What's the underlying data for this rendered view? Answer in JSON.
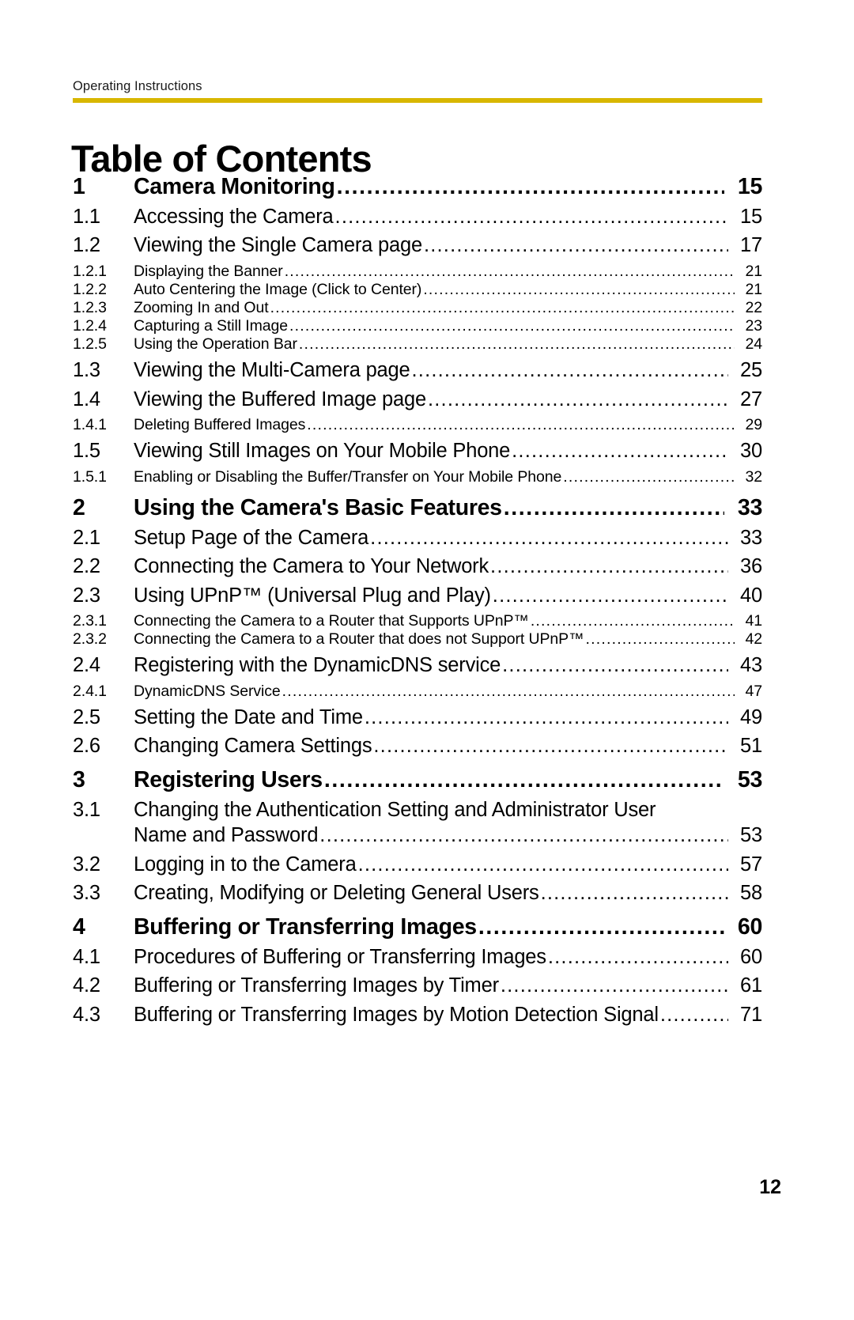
{
  "document": {
    "running_header": "Operating Instructions",
    "title": "Table of Contents",
    "footer_page_number": "12",
    "accent_rule_color": "#d8b700",
    "text_color": "#000000",
    "background_color": "#ffffff"
  },
  "toc": {
    "entries": [
      {
        "level": "chapter",
        "num": "1",
        "label": "Camera Monitoring",
        "page": "15"
      },
      {
        "level": "section",
        "num": "1.1",
        "label": "Accessing the Camera",
        "page": "15"
      },
      {
        "level": "section",
        "num": "1.2",
        "label": "Viewing the Single Camera page",
        "page": "17"
      },
      {
        "level": "sub",
        "num": "1.2.1",
        "label": "Displaying the Banner",
        "page": "21"
      },
      {
        "level": "sub",
        "num": "1.2.2",
        "label": "Auto Centering the Image (Click to Center)",
        "page": "21"
      },
      {
        "level": "sub",
        "num": "1.2.3",
        "label": "Zooming In and Out",
        "page": "22"
      },
      {
        "level": "sub",
        "num": "1.2.4",
        "label": "Capturing a Still Image",
        "page": "23"
      },
      {
        "level": "sub",
        "num": "1.2.5",
        "label": "Using the Operation Bar",
        "page": "24"
      },
      {
        "level": "section",
        "num": "1.3",
        "label": "Viewing the Multi-Camera page",
        "page": "25"
      },
      {
        "level": "section",
        "num": "1.4",
        "label": "Viewing the Buffered Image page",
        "page": "27"
      },
      {
        "level": "sub",
        "num": "1.4.1",
        "label": "Deleting Buffered Images",
        "page": "29"
      },
      {
        "level": "section",
        "num": "1.5",
        "label": "Viewing Still Images on Your Mobile Phone",
        "page": "30"
      },
      {
        "level": "sub",
        "num": "1.5.1",
        "label": "Enabling or Disabling the Buffer/Transfer on Your Mobile Phone",
        "page": "32"
      },
      {
        "level": "chapter",
        "num": "2",
        "label": "Using the Camera's Basic Features",
        "page": "33"
      },
      {
        "level": "section",
        "num": "2.1",
        "label": "Setup Page of the Camera",
        "page": "33"
      },
      {
        "level": "section",
        "num": "2.2",
        "label": "Connecting the Camera to Your Network",
        "page": "36"
      },
      {
        "level": "section",
        "num": "2.3",
        "label": "Using UPnP™ (Universal Plug and Play)",
        "page": "40"
      },
      {
        "level": "sub",
        "num": "2.3.1",
        "label": "Connecting the Camera to a Router that Supports UPnP™",
        "page": "41"
      },
      {
        "level": "sub",
        "num": "2.3.2",
        "label": "Connecting the Camera to a Router that does not Support UPnP™",
        "page": "42"
      },
      {
        "level": "section",
        "num": "2.4",
        "label": "Registering with the DynamicDNS service",
        "page": "43"
      },
      {
        "level": "sub",
        "num": "2.4.1",
        "label": "DynamicDNS Service",
        "page": "47"
      },
      {
        "level": "section",
        "num": "2.5",
        "label": "Setting the Date and Time",
        "page": "49"
      },
      {
        "level": "section",
        "num": "2.6",
        "label": "Changing Camera Settings",
        "page": "51"
      },
      {
        "level": "chapter",
        "num": "3",
        "label": "Registering Users",
        "page": "53"
      },
      {
        "level": "section-wrap",
        "num": "3.1",
        "label_line1": "Changing the Authentication Setting and Administrator User",
        "label_line2": "Name and Password",
        "page": "53"
      },
      {
        "level": "section",
        "num": "3.2",
        "label": "Logging in to the Camera",
        "page": "57"
      },
      {
        "level": "section",
        "num": "3.3",
        "label": "Creating, Modifying or Deleting General Users",
        "page": "58"
      },
      {
        "level": "chapter",
        "num": "4",
        "label": "Buffering or Transferring Images",
        "page": "60"
      },
      {
        "level": "section",
        "num": "4.1",
        "label": "Procedures of Buffering or Transferring Images",
        "page": "60"
      },
      {
        "level": "section",
        "num": "4.2",
        "label": "Buffering or Transferring Images by Timer",
        "page": "61"
      },
      {
        "level": "section",
        "num": "4.3",
        "label": "Buffering or Transferring Images by Motion Detection Signal",
        "page": "71"
      }
    ]
  }
}
